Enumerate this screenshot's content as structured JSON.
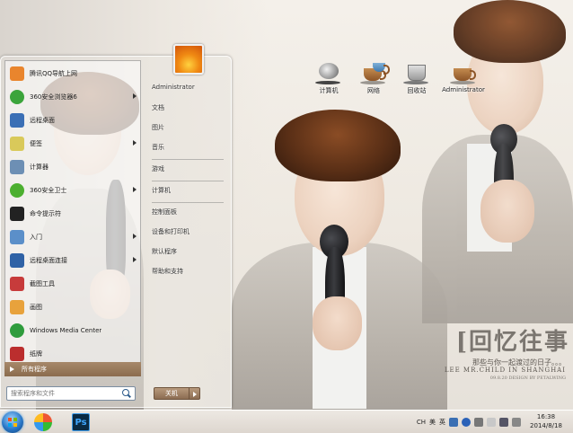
{
  "desktop": {
    "icons": [
      {
        "label": "计算机",
        "icon": "computer-icon"
      },
      {
        "label": "网络",
        "icon": "network-icon"
      },
      {
        "label": "回收站",
        "icon": "recycle-bin-icon"
      },
      {
        "label": "Administrator",
        "icon": "user-folder-icon"
      }
    ],
    "wallpaper": {
      "title": "[回忆往事",
      "subtitle": "那些与你一起渡过的日子。。。",
      "english": "LEE MR.CHILD  IN  SHANGHAI",
      "design": "09.8.20 DESIGN BY PETALWING"
    }
  },
  "start_menu": {
    "programs": [
      {
        "label": "腾讯QQ导航上网",
        "icon": "qq-nav-icon",
        "color": "#e9852d",
        "has_submenu": false
      },
      {
        "label": "360安全浏览器6",
        "icon": "360-browser-icon",
        "color": "#3ba43b",
        "has_submenu": true
      },
      {
        "label": "远程桌面",
        "icon": "remote-desktop-icon",
        "color": "#3b6fb5",
        "has_submenu": false
      },
      {
        "label": "便签",
        "icon": "sticky-notes-icon",
        "color": "#d9c95a",
        "has_submenu": true
      },
      {
        "label": "计算器",
        "icon": "calculator-icon",
        "color": "#6d8fb4",
        "has_submenu": false
      },
      {
        "label": "360安全卫士",
        "icon": "360-safe-icon",
        "color": "#4caf2f",
        "has_submenu": true
      },
      {
        "label": "命令提示符",
        "icon": "cmd-icon",
        "color": "#222222",
        "has_submenu": false
      },
      {
        "label": "入门",
        "icon": "getting-started-icon",
        "color": "#5b8fc9",
        "has_submenu": true
      },
      {
        "label": "远程桌面连接",
        "icon": "rdp-icon",
        "color": "#2f62a6",
        "has_submenu": true
      },
      {
        "label": "截图工具",
        "icon": "snipping-tool-icon",
        "color": "#c73b3b",
        "has_submenu": false
      },
      {
        "label": "画图",
        "icon": "paint-icon",
        "color": "#e8a23c",
        "has_submenu": false
      },
      {
        "label": "Windows Media Center",
        "icon": "media-center-icon",
        "color": "#2f9c3d",
        "has_submenu": false
      },
      {
        "label": "纸牌",
        "icon": "solitaire-icon",
        "color": "#bb2e2e",
        "has_submenu": false
      }
    ],
    "all_programs": "所有程序",
    "search_placeholder": "搜索程序和文件",
    "right_items": [
      "Administrator",
      "文档",
      "图片",
      "音乐",
      "游戏",
      "计算机",
      "控制面板",
      "设备和打印机",
      "默认程序",
      "帮助和支持"
    ],
    "shutdown": "关机"
  },
  "taskbar": {
    "apps": [
      {
        "name": "start-button",
        "icon": "windows-orb-icon"
      },
      {
        "name": "color-app",
        "icon": "color-wheel-icon"
      },
      {
        "name": "photoshop",
        "icon": "photoshop-icon",
        "label": "Ps"
      }
    ],
    "tray": {
      "lang": "CH",
      "ime": "美",
      "misc": "英"
    },
    "time": "16:38",
    "date": "2014/8/18"
  }
}
